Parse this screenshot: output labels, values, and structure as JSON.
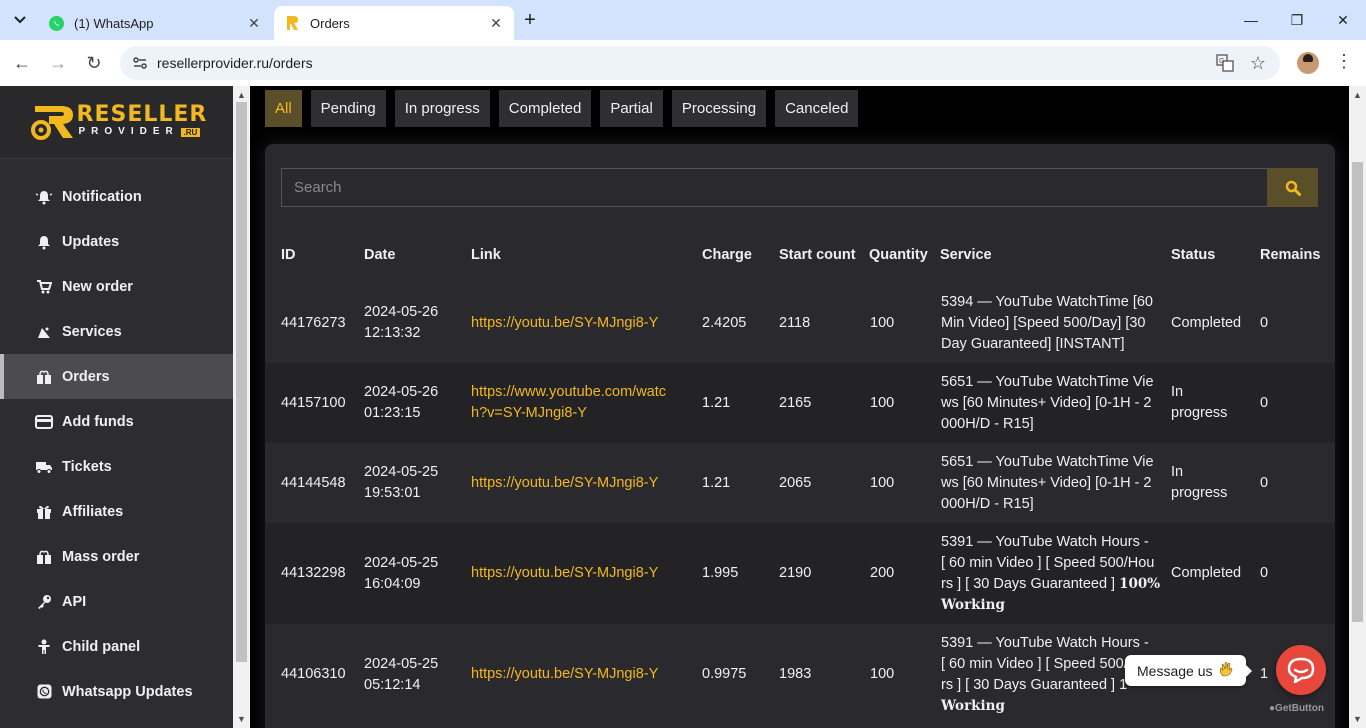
{
  "browser": {
    "tabs": [
      {
        "title": "(1) WhatsApp",
        "active": false
      },
      {
        "title": "Orders",
        "active": true
      }
    ],
    "url": "resellerprovider.ru/orders"
  },
  "logo": {
    "word1": "RESELLER",
    "word2": "PROVIDER",
    "suffix": ".RU"
  },
  "sidebar": {
    "items": [
      {
        "label": "Notification",
        "icon": "bell-ring-icon"
      },
      {
        "label": "Updates",
        "icon": "bell-icon"
      },
      {
        "label": "New order",
        "icon": "cart-icon"
      },
      {
        "label": "Services",
        "icon": "satellite-icon"
      },
      {
        "label": "Orders",
        "icon": "box-icon",
        "active": true
      },
      {
        "label": "Add funds",
        "icon": "credit-card-icon"
      },
      {
        "label": "Tickets",
        "icon": "truck-icon"
      },
      {
        "label": "Affiliates",
        "icon": "gift-icon"
      },
      {
        "label": "Mass order",
        "icon": "box-icon"
      },
      {
        "label": "API",
        "icon": "key-icon"
      },
      {
        "label": "Child panel",
        "icon": "child-icon"
      },
      {
        "label": "Whatsapp Updates",
        "icon": "whatsapp-icon"
      }
    ]
  },
  "filters": [
    "All",
    "Pending",
    "In progress",
    "Completed",
    "Partial",
    "Processing",
    "Canceled"
  ],
  "search": {
    "placeholder": "Search"
  },
  "table": {
    "headers": [
      "ID",
      "Date",
      "Link",
      "Charge",
      "Start count",
      "Quantity",
      "Service",
      "Status",
      "Remains"
    ],
    "rows": [
      {
        "id": "44176273",
        "date1": "2024-05-26",
        "date2": "12:13:32",
        "link1": "https://youtu.be/SY-MJngi8-Y",
        "link2": "",
        "charge": "2.4205",
        "start": "2118",
        "qty": "100",
        "svc1": "5394 — YouTube WatchTime [60",
        "svc2": "Min Video] [Speed 500/Day] [30",
        "svc3": "Day Guaranteed] [INSTANT]",
        "svc4": "",
        "status1": "Completed",
        "status2": "",
        "remains": "0"
      },
      {
        "id": "44157100",
        "date1": "2024-05-26",
        "date2": "01:23:15",
        "link1": "https://www.youtube.com/watc",
        "link2": "h?v=SY-MJngi8-Y",
        "charge": "1.21",
        "start": "2165",
        "qty": "100",
        "svc1": "5651 — YouTube WatchTime Vie",
        "svc2": "ws [60 Minutes+ Video] [0-1H - 2",
        "svc3": "000H/D - R15]",
        "svc4": "",
        "status1": "In",
        "status2": "progress",
        "remains": "0"
      },
      {
        "id": "44144548",
        "date1": "2024-05-25",
        "date2": "19:53:01",
        "link1": "https://youtu.be/SY-MJngi8-Y",
        "link2": "",
        "charge": "1.21",
        "start": "2065",
        "qty": "100",
        "svc1": "5651 — YouTube WatchTime Vie",
        "svc2": "ws [60 Minutes+ Video] [0-1H - 2",
        "svc3": "000H/D - R15]",
        "svc4": "",
        "status1": "In",
        "status2": "progress",
        "remains": "0"
      },
      {
        "id": "44132298",
        "date1": "2024-05-25",
        "date2": "16:04:09",
        "link1": "https://youtu.be/SY-MJngi8-Y",
        "link2": "",
        "charge": "1.995",
        "start": "2190",
        "qty": "200",
        "svc1": "5391 — YouTube Watch Hours -",
        "svc2": "[ 60 min Video ] [ Speed 500/Hou",
        "svc3": "rs ] [ 30 Days Guaranteed ]",
        "svc3b": "100%",
        "svc4": "Working",
        "status1": "Completed",
        "status2": "",
        "remains": "0"
      },
      {
        "id": "44106310",
        "date1": "2024-05-25",
        "date2": "05:12:14",
        "link1": "https://youtu.be/SY-MJngi8-Y",
        "link2": "",
        "charge": "0.9975",
        "start": "1983",
        "qty": "100",
        "svc1": "5391 — YouTube Watch Hours -",
        "svc2": "[ 60 min Video ] [ Speed 500/H",
        "svc3": "rs ] [ 30 Days Guaranteed ] 1",
        "svc3b": "",
        "svc4": "Working",
        "status1": "",
        "status2": "",
        "remains": "1"
      }
    ]
  },
  "chat": {
    "message": "Message us",
    "brand": "GetButton"
  }
}
